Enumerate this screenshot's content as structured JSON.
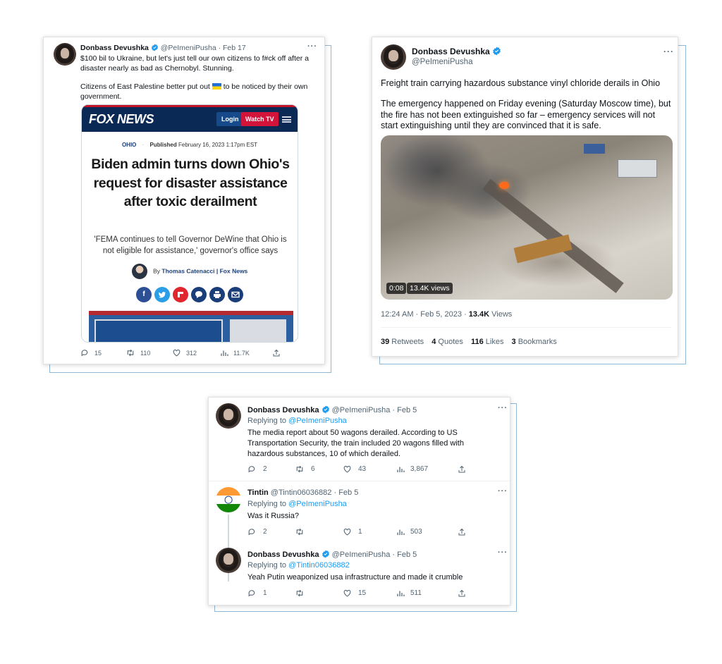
{
  "tweet1": {
    "name": "Donbass Devushka",
    "handle": "@PeImeniPusha",
    "date": "Feb 17",
    "text1": "$100 bil to Ukraine, but let's just tell our own citizens to f#ck off after a disaster nearly as bad as Chernobyl. Stunning.",
    "text2_a": "Citizens of East Palestine better put out ",
    "text2_b": " to be noticed by their own government.",
    "flag_emoji_colors": [
      "#1f6fd6",
      "#ffd60a"
    ],
    "article": {
      "logo": "FOX NEWS",
      "login": "Login",
      "watch": "Watch TV",
      "section": "OHIO",
      "published_label": "Published",
      "published_date": "February 16, 2023 1:17pm EST",
      "headline": "Biden admin turns down Ohio's request for disaster assistance after toxic derailment",
      "subhead": "'FEMA continues to tell Governor DeWine that Ohio is not eligible for assistance,' governor's office says",
      "by": "By",
      "author": "Thomas Catenacci | Fox News",
      "share_icons": [
        "facebook-icon",
        "twitter-icon",
        "flipboard-icon",
        "comment-icon",
        "print-icon",
        "email-icon"
      ]
    },
    "stats": {
      "replies": "15",
      "retweets": "110",
      "likes": "312",
      "views": "11.7K"
    }
  },
  "tweet2": {
    "name": "Donbass Devushka",
    "handle": "@PeImeniPusha",
    "text1": "Freight train carrying hazardous substance vinyl chloride derails in Ohio",
    "text2": "The emergency happened on Friday evening (Saturday Moscow time), but the fire has not been extinguished so far – emergency services will not start extinguishing until they are convinced that it is safe.",
    "video_time": "0:08",
    "video_views": "13.4K views",
    "timestamp": "12:24 AM · Feb 5, 2023 · ",
    "views_count": "13.4K",
    "views_label": " Views",
    "retweets": "39",
    "retweets_label": " Retweets",
    "quotes": "4",
    "quotes_label": " Quotes",
    "likes": "116",
    "likes_label": " Likes",
    "bookmarks": "3",
    "bookmarks_label": " Bookmarks"
  },
  "thread": {
    "t1": {
      "name": "Donbass Devushka",
      "handle": "@PeImeniPusha",
      "date": "Feb 5",
      "replying": "Replying to ",
      "replying_to": "@PeImeniPusha",
      "text": "The media report about 50 wagons derailed. According to US Transportation Security, the train included 20 wagons filled with hazardous substances, 10 of which derailed.",
      "stats": {
        "replies": "2",
        "retweets": "6",
        "likes": "43",
        "views": "3,867"
      }
    },
    "t2": {
      "name": "Tintin",
      "handle": "@Tintin06036882",
      "date": "Feb 5",
      "replying": "Replying to ",
      "replying_to": "@PeImeniPusha",
      "text": "Was it Russia?",
      "stats": {
        "replies": "2",
        "retweets": "",
        "likes": "1",
        "views": "503"
      }
    },
    "t3": {
      "name": "Donbass Devushka",
      "handle": "@PeImeniPusha",
      "date": "Feb 5",
      "replying": "Replying to ",
      "replying_to": "@Tintin06036882",
      "text": "Yeah Putin weaponized usa infrastructure and made it crumble",
      "stats": {
        "replies": "1",
        "retweets": "",
        "likes": "15",
        "views": "511"
      }
    }
  },
  "separator": "·",
  "more": "···",
  "colors": {
    "accent": "#1d9bf0",
    "fox_navy": "#0a2a55",
    "fox_red": "#d3143a",
    "text": "#0f1419",
    "muted": "#536471"
  }
}
